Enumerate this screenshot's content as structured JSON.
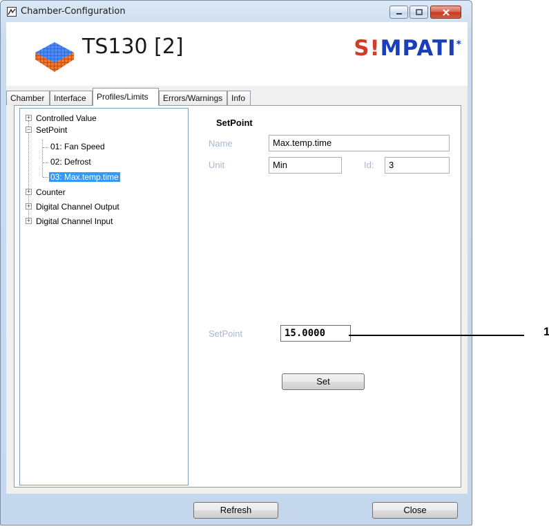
{
  "window": {
    "title": "Chamber-Configuration"
  },
  "header": {
    "device_name": "TS130 [2]",
    "brand_s": "S",
    "brand_i": "!",
    "brand_rest": "MPATI",
    "brand_mark": "*"
  },
  "tabs": [
    {
      "label": "Chamber"
    },
    {
      "label": "Interface"
    },
    {
      "label": "Profiles/Limits"
    },
    {
      "label": "Errors/Warnings"
    },
    {
      "label": "Info"
    }
  ],
  "tree": {
    "items": [
      {
        "label": "Controlled Value"
      },
      {
        "label": "SetPoint"
      },
      {
        "label": "01: Fan Speed"
      },
      {
        "label": "02: Defrost"
      },
      {
        "label": "03: Max.temp.time"
      },
      {
        "label": "Counter"
      },
      {
        "label": "Digital Channel Output"
      },
      {
        "label": "Digital Channel Input"
      }
    ]
  },
  "detail": {
    "section_title": "SetPoint",
    "name_label": "Name",
    "name_value": "Max.temp.time",
    "unit_label": "Unit",
    "unit_value": "Min",
    "id_label": "Id:",
    "id_value": "3",
    "setpoint_label": "SetPoint",
    "setpoint_value": "15.0000",
    "set_button": "Set"
  },
  "footer": {
    "refresh_button": "Refresh",
    "close_button": "Close"
  },
  "callout": {
    "number": "1"
  },
  "colors": {
    "selection": "#3399ff",
    "brand_red": "#d13b2a",
    "brand_blue": "#1b3fb8"
  }
}
